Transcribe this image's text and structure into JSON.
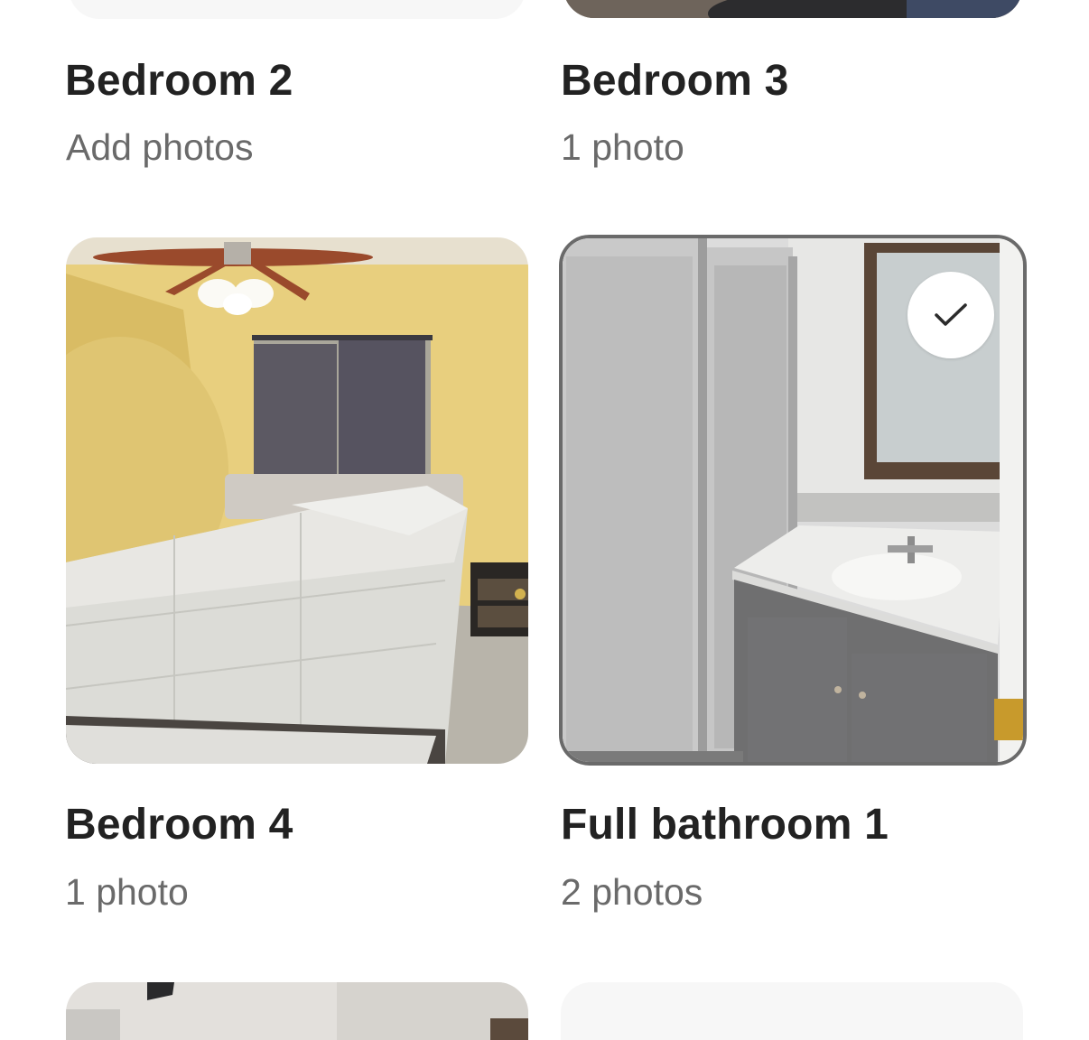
{
  "categories": [
    {
      "title": "Bedroom 2",
      "subtitle": "Add photos",
      "selected": false
    },
    {
      "title": "Bedroom 3",
      "subtitle": "1 photo",
      "selected": false
    },
    {
      "title": "Bedroom 4",
      "subtitle": "1 photo",
      "selected": false
    },
    {
      "title": "Full bathroom 1",
      "subtitle": "2 photos",
      "selected": true
    }
  ],
  "icons": {
    "check": "check-icon"
  },
  "colors": {
    "title": "#222222",
    "subtitle": "#6a6a6a",
    "placeholder": "#f7f7f7",
    "selected_border": "#6a6a6a"
  }
}
